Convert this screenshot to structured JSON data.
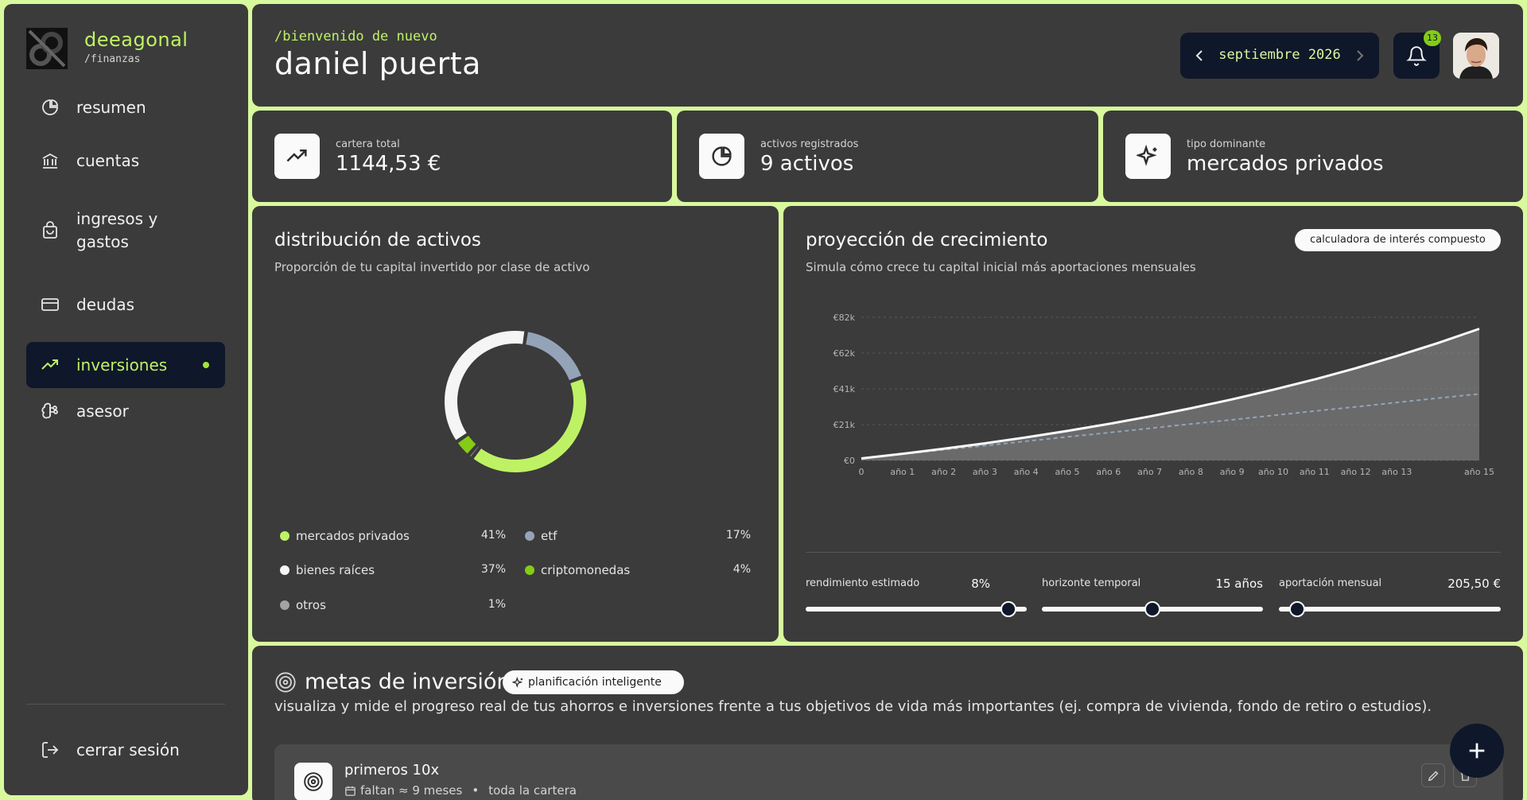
{
  "brand": {
    "name": "deeagonal",
    "sub": "/finanzas"
  },
  "nav": [
    {
      "label": "resumen",
      "icon": "pie-chart-icon"
    },
    {
      "label": "cuentas",
      "icon": "bank-icon"
    },
    {
      "label": "ingresos y gastos",
      "icon": "shopping-bag-icon"
    },
    {
      "label": "deudas",
      "icon": "credit-card-icon"
    },
    {
      "label": "inversiones",
      "icon": "trending-up-icon",
      "active": true
    },
    {
      "label": "asesor",
      "icon": "brain-icon"
    }
  ],
  "logout_label": "cerrar sesión",
  "header": {
    "greeting": "/bienvenido de nuevo",
    "user_name": "daniel puerta",
    "month": "septiembre 2026",
    "notifications": "13"
  },
  "stats": [
    {
      "label": "cartera total",
      "value": "1144,53 €",
      "icon": "trending-up-icon"
    },
    {
      "label": "activos registrados",
      "value": "9 activos",
      "icon": "pie-chart-icon"
    },
    {
      "label": "tipo dominante",
      "value": "mercados privados",
      "icon": "sparkles-icon"
    }
  ],
  "distribution": {
    "title": "distribución de activos",
    "subtitle": "Proporción de tu capital invertido por clase de activo",
    "legend": [
      {
        "name": "mercados privados",
        "pct": "41%",
        "color": "#bef264"
      },
      {
        "name": "etf",
        "pct": "17%",
        "color": "#94a3b8"
      },
      {
        "name": "bienes raíces",
        "pct": "37%",
        "color": "#f5f5f5"
      },
      {
        "name": "criptomonedas",
        "pct": "4%",
        "color": "#84cc16"
      },
      {
        "name": "otros",
        "pct": "1%",
        "color": "#a3a3a3"
      }
    ]
  },
  "chart_data": {
    "type": "pie",
    "categories": [
      "mercados privados",
      "etf",
      "bienes raíces",
      "criptomonedas",
      "otros"
    ],
    "values": [
      41,
      17,
      37,
      4,
      1
    ]
  },
  "projection": {
    "title": "proyección de crecimiento",
    "subtitle": "Simula cómo crece tu capital inicial más aportaciones mensuales",
    "calculator_label": "calculadora de interés compuesto",
    "y_ticks": [
      "€0",
      "€21k",
      "€41k",
      "€62k",
      "€82k"
    ],
    "x_ticks": [
      "0",
      "año 1",
      "año 2",
      "año 3",
      "año 4",
      "año 5",
      "año 6",
      "año 7",
      "año 8",
      "año 9",
      "año 10",
      "año 11",
      "año 12",
      "año 13",
      "año 15"
    ],
    "sliders": [
      {
        "label": "rendimiento estimado",
        "value": "8%",
        "level": 0.95
      },
      {
        "label": "horizonte temporal",
        "value": "15 años",
        "level": 0.5
      },
      {
        "label": "aportación mensual",
        "value": "205,50 €",
        "level": 0.05
      }
    ]
  },
  "growth_chart_data": {
    "type": "area",
    "x": [
      0,
      1,
      2,
      3,
      4,
      5,
      6,
      7,
      8,
      9,
      10,
      11,
      12,
      13,
      14,
      15
    ],
    "series": [
      {
        "values": [
          1145,
          3800,
          6700,
          9800,
          13200,
          16900,
          20900,
          25200,
          29900,
          35000,
          40500,
          46400,
          52800,
          59800,
          67300,
          75400
        ]
      },
      {
        "values": [
          1145,
          3600,
          6100,
          8500,
          11000,
          13500,
          15900,
          18400,
          20900,
          23300,
          25800,
          28300,
          30700,
          33200,
          35700,
          38100
        ]
      }
    ],
    "ylim": [
      0,
      82000
    ]
  },
  "goals": {
    "title": "metas de inversión",
    "pill": "planificación inteligente",
    "description": "visualiza y mide el progreso real de tus ahorros e inversiones frente a tus objetivos de vida más importantes (ej. compra de vivienda, fondo de retiro o estudios).",
    "items": [
      {
        "name": "primeros 10x",
        "eta": "faltan ≈ 9 meses",
        "scope": "toda la cartera"
      }
    ]
  }
}
